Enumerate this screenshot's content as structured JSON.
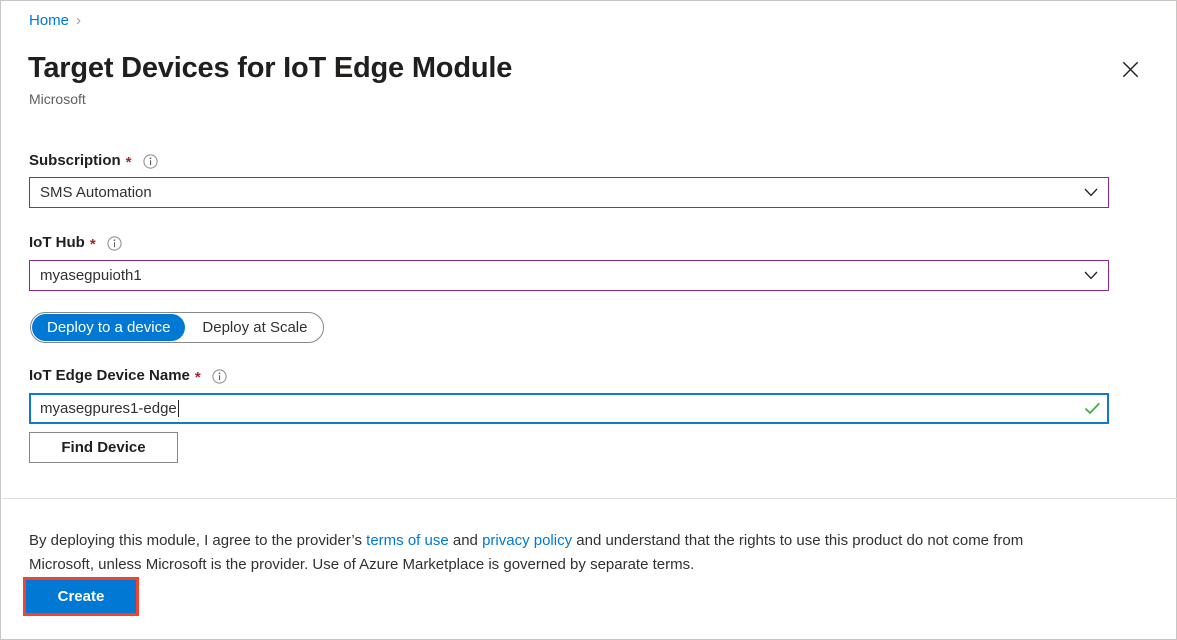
{
  "breadcrumb": {
    "items": [
      {
        "label": "Home",
        "separator": "›"
      }
    ]
  },
  "header": {
    "title": "Target Devices for IoT Edge Module",
    "publisher": "Microsoft",
    "close_icon": "close-icon"
  },
  "form": {
    "subscription": {
      "label": "Subscription",
      "required_marker": "*",
      "info_icon": "info-icon",
      "value": "SMS Automation",
      "chevron_icon": "chevron-down-icon"
    },
    "iot_hub": {
      "label": "IoT Hub",
      "required_marker": "*",
      "info_icon": "info-icon",
      "value": "myasegpuioth1",
      "chevron_icon": "chevron-down-icon"
    },
    "deployment_mode": {
      "options": [
        {
          "label": "Deploy to a device",
          "selected": true
        },
        {
          "label": "Deploy at Scale",
          "selected": false
        }
      ]
    },
    "device_name": {
      "label": "IoT Edge Device Name",
      "required_marker": "*",
      "info_icon": "info-icon",
      "value": "myasegpures1-edge",
      "validation_icon": "checkmark-icon",
      "validation_color": "#3faf3f"
    },
    "find_device_button": {
      "label": "Find Device"
    }
  },
  "footer": {
    "legal_text_1": "By deploying this module, I agree to the provider’s ",
    "terms_link": "terms of use",
    "legal_text_2": " and ",
    "privacy_link": "privacy policy",
    "legal_text_3": " and understand that the rights to use this product do not come from Microsoft, unless Microsoft is the provider. Use of Azure Marketplace is governed by separate terms.",
    "create_button": {
      "label": "Create"
    }
  },
  "colors": {
    "accent_blue": "#0078d4",
    "link_blue": "#0078d4",
    "combo_border_purple": "#8a2b8c",
    "focus_border_blue": "#0f7ad4",
    "required_red": "#a4262c",
    "highlight_red": "#f6412d",
    "check_green": "#3faf3f"
  }
}
